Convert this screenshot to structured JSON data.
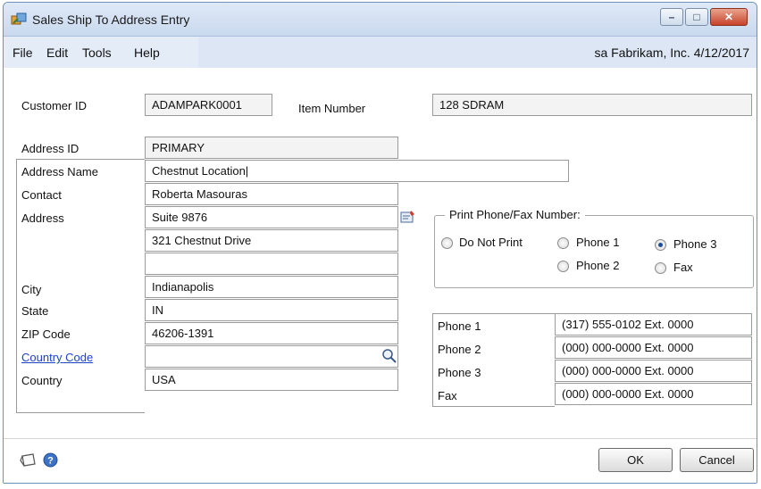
{
  "window": {
    "title": "Sales Ship To Address Entry"
  },
  "menu": {
    "file": "File",
    "edit": "Edit",
    "tools": "Tools",
    "help": "Help"
  },
  "user_info": "sa  Fabrikam, Inc.  4/12/2017",
  "customer": {
    "customer_id_label": "Customer ID",
    "customer_id": "ADAMPARK0001",
    "item_number_label": "Item Number",
    "item_number": "128 SDRAM"
  },
  "address": {
    "address_id_label": "Address ID",
    "address_id": "PRIMARY",
    "address_name_label": "Address Name",
    "address_name": "Chestnut Location|",
    "contact_label": "Contact",
    "contact": "Roberta Masouras",
    "address_label": "Address",
    "address_line1": "Suite 9876",
    "address_line2": "321 Chestnut Drive",
    "address_line3": "",
    "city_label": "City",
    "city": "Indianapolis",
    "state_label": "State",
    "state": "IN",
    "zip_label": "ZIP Code",
    "zip": "46206-1391",
    "country_code_label": "Country Code",
    "country_code": "",
    "country_label": "Country",
    "country": "USA"
  },
  "print_phone": {
    "title": "Print Phone/Fax Number:",
    "options": {
      "do_not_print": "Do Not Print",
      "phone1": "Phone 1",
      "phone2": "Phone 2",
      "phone3": "Phone 3",
      "fax": "Fax"
    },
    "selected": "Phone 3"
  },
  "phones": {
    "phone1_label": "Phone 1",
    "phone1": "(317) 555-0102  Ext. 0000",
    "phone2_label": "Phone 2",
    "phone2": "(000) 000-0000  Ext. 0000",
    "phone3_label": "Phone 3",
    "phone3": "(000) 000-0000  Ext. 0000",
    "fax_label": "Fax",
    "fax": "(000) 000-0000  Ext. 0000"
  },
  "buttons": {
    "ok": "OK",
    "cancel": "Cancel"
  },
  "icons": {
    "app": "sales-ship-icon",
    "note": "note-icon",
    "help": "help-icon",
    "address_lookup": "address-card-icon",
    "lookup": "magnifier-icon"
  },
  "colors": {
    "title_bar": "#c9d9ee",
    "menu_bar": "#dce6f4",
    "link": "#1b44c8",
    "close_button": "#c7432a"
  }
}
